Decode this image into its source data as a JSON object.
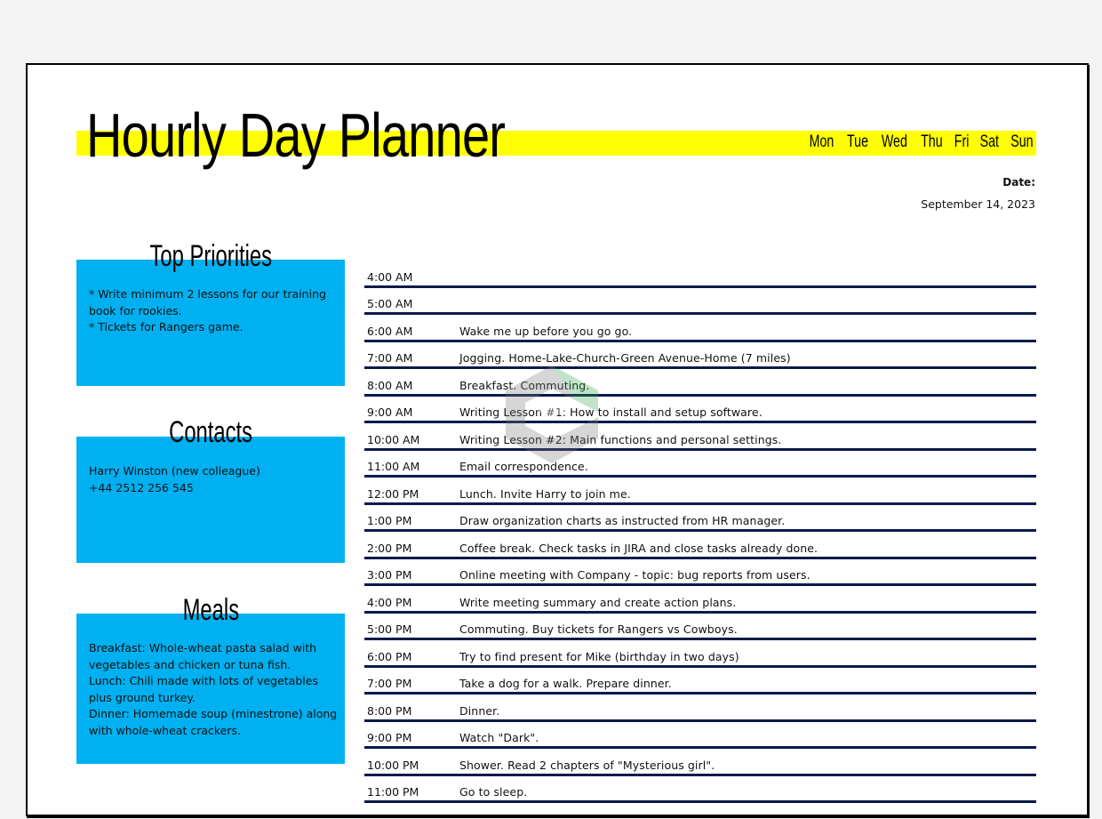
{
  "planner": {
    "title": "Hourly Day Planner",
    "weekdays": [
      "Mon",
      "Tue",
      "Wed",
      "Thu",
      "Fri",
      "Sat",
      "Sun"
    ],
    "date_label": "Date:",
    "date_value": "September 14, 2023",
    "colors": {
      "title_band": "#ffff00",
      "box_fill": "#00b0f0",
      "row_rule": "#0a1a4a"
    }
  },
  "priorities": {
    "title": "Top Priorities",
    "lines": [
      "* Write minimum 2 lessons for our training book for rookies.",
      "* Tickets for Rangers game."
    ]
  },
  "contacts": {
    "title": "Contacts",
    "lines": [
      "Harry Winston (new colleague)",
      "+44 2512 256 545"
    ]
  },
  "meals": {
    "title": "Meals",
    "lines": [
      "Breakfast: Whole-wheat pasta salad with vegetables and chicken or tuna fish.",
      "Lunch: Chili made with lots of vegetables plus ground turkey.",
      "Dinner: Homemade soup (minestrone) along with whole-wheat crackers."
    ]
  },
  "schedule": [
    {
      "time": "4:00 AM",
      "task": ""
    },
    {
      "time": "5:00 AM",
      "task": ""
    },
    {
      "time": "6:00 AM",
      "task": "Wake me up before you go go."
    },
    {
      "time": "7:00 AM",
      "task": "Jogging. Home-Lake-Church-Green Avenue-Home (7 miles)"
    },
    {
      "time": "8:00 AM",
      "task": "Breakfast. Commuting."
    },
    {
      "time": "9:00 AM",
      "task": "Writing Lesson #1: How to install and setup software."
    },
    {
      "time": "10:00 AM",
      "task": "Writing Lesson #2: Main functions and personal settings."
    },
    {
      "time": "11:00 AM",
      "task": "Email correspondence."
    },
    {
      "time": "12:00 PM",
      "task": "Lunch. Invite Harry to join me."
    },
    {
      "time": "1:00 PM",
      "task": "Draw organization charts as instructed from HR manager."
    },
    {
      "time": "2:00 PM",
      "task": "Coffee break. Check tasks in JIRA and close tasks already done."
    },
    {
      "time": "3:00 PM",
      "task": "Online meeting with Company - topic: bug reports from users."
    },
    {
      "time": "4:00 PM",
      "task": "Write meeting summary and create action plans."
    },
    {
      "time": "5:00 PM",
      "task": "Commuting. Buy tickets for Rangers vs Cowboys."
    },
    {
      "time": "6:00 PM",
      "task": "Try to find present for Mike (birthday in two days)"
    },
    {
      "time": "7:00 PM",
      "task": "Take a dog for a walk. Prepare dinner."
    },
    {
      "time": "8:00 PM",
      "task": "Dinner."
    },
    {
      "time": "9:00 PM",
      "task": "Watch \"Dark\"."
    },
    {
      "time": "10:00 PM",
      "task": "Shower. Read 2 chapters of \"Mysterious girl\"."
    },
    {
      "time": "11:00 PM",
      "task": "Go to sleep."
    }
  ],
  "watermark_icon": "logo-watermark-icon"
}
